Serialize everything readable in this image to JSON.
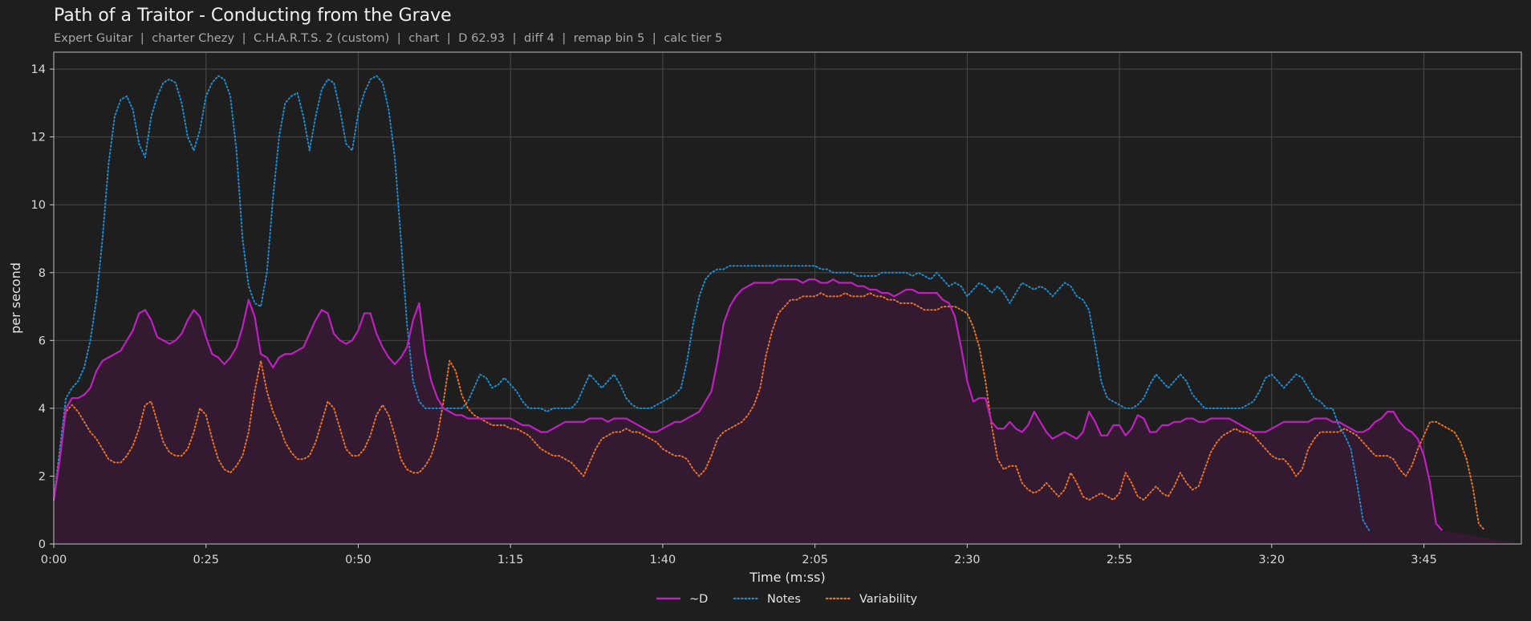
{
  "page": {
    "title": "Path of a Traitor - Conducting from the Grave",
    "subtitle": "Expert Guitar  |  charter Chezy  |  C.H.A.R.T.S. 2 (custom)  |  chart  |  D 62.93  |  diff 4  |  remap bin 5  |  calc tier 5"
  },
  "chart_data": {
    "type": "line",
    "title": "Path of a Traitor - Conducting from the Grave",
    "xlabel": "Time (m:ss)",
    "ylabel": "per second",
    "xlim": [
      0,
      241
    ],
    "ylim": [
      0,
      14.5
    ],
    "grid": true,
    "legend_position": "bottom-center",
    "x_ticks": [
      {
        "value": 0,
        "label": "0:00"
      },
      {
        "value": 25,
        "label": "0:25"
      },
      {
        "value": 50,
        "label": "0:50"
      },
      {
        "value": 75,
        "label": "1:15"
      },
      {
        "value": 100,
        "label": "1:40"
      },
      {
        "value": 125,
        "label": "2:05"
      },
      {
        "value": 150,
        "label": "2:30"
      },
      {
        "value": 175,
        "label": "2:55"
      },
      {
        "value": 200,
        "label": "3:20"
      },
      {
        "value": 225,
        "label": "3:45"
      }
    ],
    "y_ticks": [
      {
        "value": 0,
        "label": "0"
      },
      {
        "value": 2,
        "label": "2"
      },
      {
        "value": 4,
        "label": "4"
      },
      {
        "value": 6,
        "label": "6"
      },
      {
        "value": 8,
        "label": "8"
      },
      {
        "value": 10,
        "label": "10"
      },
      {
        "value": 12,
        "label": "12"
      },
      {
        "value": 14,
        "label": "14"
      }
    ],
    "x": [
      0,
      1,
      2,
      3,
      4,
      5,
      6,
      7,
      8,
      9,
      10,
      11,
      12,
      13,
      14,
      15,
      16,
      17,
      18,
      19,
      20,
      21,
      22,
      23,
      24,
      25,
      26,
      27,
      28,
      29,
      30,
      31,
      32,
      33,
      34,
      35,
      36,
      37,
      38,
      39,
      40,
      41,
      42,
      43,
      44,
      45,
      46,
      47,
      48,
      49,
      50,
      51,
      52,
      53,
      54,
      55,
      56,
      57,
      58,
      59,
      60,
      61,
      62,
      63,
      64,
      65,
      66,
      67,
      68,
      69,
      70,
      71,
      72,
      73,
      74,
      75,
      76,
      77,
      78,
      79,
      80,
      81,
      82,
      83,
      84,
      85,
      86,
      87,
      88,
      89,
      90,
      91,
      92,
      93,
      94,
      95,
      96,
      97,
      98,
      99,
      100,
      101,
      102,
      103,
      104,
      105,
      106,
      107,
      108,
      109,
      110,
      111,
      112,
      113,
      114,
      115,
      116,
      117,
      118,
      119,
      120,
      121,
      122,
      123,
      124,
      125,
      126,
      127,
      128,
      129,
      130,
      131,
      132,
      133,
      134,
      135,
      136,
      137,
      138,
      139,
      140,
      141,
      142,
      143,
      144,
      145,
      146,
      147,
      148,
      149,
      150,
      151,
      152,
      153,
      154,
      155,
      156,
      157,
      158,
      159,
      160,
      161,
      162,
      163,
      164,
      165,
      166,
      167,
      168,
      169,
      170,
      171,
      172,
      173,
      174,
      175,
      176,
      177,
      178,
      179,
      180,
      181,
      182,
      183,
      184,
      185,
      186,
      187,
      188,
      189,
      190,
      191,
      192,
      193,
      194,
      195,
      196,
      197,
      198,
      199,
      200,
      201,
      202,
      203,
      204,
      205,
      206,
      207,
      208,
      209,
      210,
      211,
      212,
      213,
      214,
      215,
      216,
      217,
      218,
      219,
      220,
      221,
      222,
      223,
      224,
      225,
      226,
      227,
      228,
      229,
      230,
      231,
      232,
      233,
      234,
      235,
      236,
      237,
      238,
      239,
      240,
      241
    ],
    "series": [
      {
        "name": "~D",
        "color": "#c020c0",
        "style": "solid",
        "fill": "#331a31",
        "values": [
          1.3,
          2.5,
          4.0,
          4.3,
          4.3,
          4.4,
          4.6,
          5.1,
          5.4,
          5.5,
          5.6,
          5.7,
          6.0,
          6.3,
          6.8,
          6.9,
          6.6,
          6.1,
          6.0,
          5.9,
          6.0,
          6.2,
          6.6,
          6.9,
          6.7,
          6.1,
          5.6,
          5.5,
          5.3,
          5.5,
          5.8,
          6.4,
          7.2,
          6.7,
          5.6,
          5.5,
          5.2,
          5.5,
          5.6,
          5.6,
          5.7,
          5.8,
          6.2,
          6.6,
          6.9,
          6.8,
          6.2,
          6.0,
          5.9,
          6.0,
          6.3,
          6.8,
          6.8,
          6.2,
          5.8,
          5.5,
          5.3,
          5.5,
          5.8,
          6.6,
          7.1,
          5.6,
          4.8,
          4.3,
          4.0,
          3.9,
          3.8,
          3.8,
          3.7,
          3.7,
          3.7,
          3.7,
          3.7,
          3.7,
          3.7,
          3.7,
          3.6,
          3.5,
          3.5,
          3.4,
          3.3,
          3.3,
          3.4,
          3.5,
          3.6,
          3.6,
          3.6,
          3.6,
          3.7,
          3.7,
          3.7,
          3.6,
          3.7,
          3.7,
          3.7,
          3.6,
          3.5,
          3.4,
          3.3,
          3.3,
          3.4,
          3.5,
          3.6,
          3.6,
          3.7,
          3.8,
          3.9,
          4.2,
          4.5,
          5.4,
          6.5,
          7.0,
          7.3,
          7.5,
          7.6,
          7.7,
          7.7,
          7.7,
          7.7,
          7.8,
          7.8,
          7.8,
          7.8,
          7.7,
          7.8,
          7.8,
          7.7,
          7.7,
          7.8,
          7.7,
          7.7,
          7.7,
          7.6,
          7.6,
          7.5,
          7.5,
          7.4,
          7.4,
          7.3,
          7.4,
          7.5,
          7.5,
          7.4,
          7.4,
          7.4,
          7.4,
          7.2,
          7.1,
          6.7,
          5.8,
          4.8,
          4.2,
          4.3,
          4.3,
          3.6,
          3.4,
          3.4,
          3.6,
          3.4,
          3.3,
          3.5,
          3.9,
          3.6,
          3.3,
          3.1,
          3.2,
          3.3,
          3.2,
          3.1,
          3.3,
          3.9,
          3.6,
          3.2,
          3.2,
          3.5,
          3.5,
          3.2,
          3.4,
          3.8,
          3.7,
          3.3,
          3.3,
          3.5,
          3.5,
          3.6,
          3.6,
          3.7,
          3.7,
          3.6,
          3.6,
          3.7,
          3.7,
          3.7,
          3.7,
          3.6,
          3.5,
          3.4,
          3.3,
          3.3,
          3.3,
          3.4,
          3.5,
          3.6,
          3.6,
          3.6,
          3.6,
          3.6,
          3.7,
          3.7,
          3.7,
          3.6,
          3.6,
          3.5,
          3.4,
          3.3,
          3.3,
          3.4,
          3.6,
          3.7,
          3.9,
          3.9,
          3.6,
          3.4,
          3.3,
          3.1,
          2.6,
          1.8,
          0.6,
          0.4
        ]
      },
      {
        "name": "Notes",
        "color": "#1f8ccc",
        "style": "dotted",
        "values": [
          1.3,
          2.8,
          4.3,
          4.6,
          4.8,
          5.2,
          6.0,
          7.2,
          9.0,
          11.2,
          12.6,
          13.1,
          13.2,
          12.8,
          11.8,
          11.4,
          12.6,
          13.2,
          13.6,
          13.7,
          13.6,
          13.0,
          12.0,
          11.6,
          12.2,
          13.2,
          13.6,
          13.8,
          13.7,
          13.2,
          11.6,
          9.0,
          7.6,
          7.1,
          7.0,
          8.0,
          10.2,
          12.0,
          13.0,
          13.2,
          13.3,
          12.6,
          11.6,
          12.6,
          13.4,
          13.7,
          13.6,
          12.8,
          11.8,
          11.6,
          12.7,
          13.3,
          13.7,
          13.8,
          13.6,
          12.8,
          11.4,
          9.0,
          6.5,
          4.8,
          4.2,
          4.0,
          4.0,
          4.0,
          4.0,
          4.0,
          4.0,
          4.0,
          4.2,
          4.6,
          5.0,
          4.9,
          4.6,
          4.7,
          4.9,
          4.7,
          4.5,
          4.2,
          4.0,
          4.0,
          4.0,
          3.9,
          4.0,
          4.0,
          4.0,
          4.0,
          4.2,
          4.6,
          5.0,
          4.8,
          4.6,
          4.8,
          5.0,
          4.7,
          4.3,
          4.1,
          4.0,
          4.0,
          4.0,
          4.1,
          4.2,
          4.3,
          4.4,
          4.6,
          5.4,
          6.5,
          7.3,
          7.8,
          8.0,
          8.1,
          8.1,
          8.2,
          8.2,
          8.2,
          8.2,
          8.2,
          8.2,
          8.2,
          8.2,
          8.2,
          8.2,
          8.2,
          8.2,
          8.2,
          8.2,
          8.2,
          8.1,
          8.1,
          8.0,
          8.0,
          8.0,
          8.0,
          7.9,
          7.9,
          7.9,
          7.9,
          8.0,
          8.0,
          8.0,
          8.0,
          8.0,
          7.9,
          8.0,
          7.9,
          7.8,
          8.0,
          7.8,
          7.6,
          7.7,
          7.6,
          7.3,
          7.5,
          7.7,
          7.6,
          7.4,
          7.6,
          7.4,
          7.1,
          7.4,
          7.7,
          7.6,
          7.5,
          7.6,
          7.5,
          7.3,
          7.5,
          7.7,
          7.6,
          7.3,
          7.2,
          6.9,
          5.9,
          4.8,
          4.3,
          4.2,
          4.1,
          4.0,
          4.0,
          4.1,
          4.3,
          4.7,
          5.0,
          4.8,
          4.6,
          4.8,
          5.0,
          4.8,
          4.4,
          4.2,
          4.0,
          4.0,
          4.0,
          4.0,
          4.0,
          4.0,
          4.0,
          4.1,
          4.2,
          4.5,
          4.9,
          5.0,
          4.8,
          4.6,
          4.8,
          5.0,
          4.9,
          4.6,
          4.3,
          4.2,
          4.0,
          4.0,
          3.5,
          3.2,
          2.8,
          1.8,
          0.7,
          0.4
        ]
      },
      {
        "name": "Variability",
        "color": "#e8732a",
        "style": "dotted",
        "values": [
          1.3,
          2.6,
          3.9,
          4.1,
          3.9,
          3.6,
          3.3,
          3.1,
          2.8,
          2.5,
          2.4,
          2.4,
          2.6,
          2.9,
          3.4,
          4.1,
          4.2,
          3.6,
          3.0,
          2.7,
          2.6,
          2.6,
          2.8,
          3.3,
          4.0,
          3.8,
          3.1,
          2.5,
          2.2,
          2.1,
          2.3,
          2.6,
          3.3,
          4.5,
          5.4,
          4.5,
          3.9,
          3.5,
          3.0,
          2.7,
          2.5,
          2.5,
          2.6,
          3.0,
          3.6,
          4.2,
          4.0,
          3.4,
          2.8,
          2.6,
          2.6,
          2.8,
          3.2,
          3.8,
          4.1,
          3.8,
          3.2,
          2.5,
          2.2,
          2.1,
          2.1,
          2.3,
          2.6,
          3.2,
          4.2,
          5.4,
          5.1,
          4.4,
          4.0,
          3.8,
          3.7,
          3.6,
          3.5,
          3.5,
          3.5,
          3.4,
          3.4,
          3.3,
          3.2,
          3.0,
          2.8,
          2.7,
          2.6,
          2.6,
          2.5,
          2.4,
          2.2,
          2.0,
          2.4,
          2.8,
          3.1,
          3.2,
          3.3,
          3.3,
          3.4,
          3.3,
          3.3,
          3.2,
          3.1,
          3.0,
          2.8,
          2.7,
          2.6,
          2.6,
          2.5,
          2.2,
          2.0,
          2.2,
          2.6,
          3.1,
          3.3,
          3.4,
          3.5,
          3.6,
          3.8,
          4.1,
          4.6,
          5.6,
          6.3,
          6.8,
          7.0,
          7.2,
          7.2,
          7.3,
          7.3,
          7.3,
          7.4,
          7.3,
          7.3,
          7.3,
          7.4,
          7.3,
          7.3,
          7.3,
          7.4,
          7.3,
          7.3,
          7.2,
          7.2,
          7.1,
          7.1,
          7.1,
          7.0,
          6.9,
          6.9,
          6.9,
          7.0,
          7.0,
          7.0,
          6.9,
          6.8,
          6.4,
          5.8,
          4.8,
          3.5,
          2.5,
          2.2,
          2.3,
          2.3,
          1.8,
          1.6,
          1.5,
          1.6,
          1.8,
          1.6,
          1.4,
          1.6,
          2.1,
          1.8,
          1.4,
          1.3,
          1.4,
          1.5,
          1.4,
          1.3,
          1.5,
          2.1,
          1.8,
          1.4,
          1.3,
          1.5,
          1.7,
          1.5,
          1.4,
          1.7,
          2.1,
          1.8,
          1.6,
          1.7,
          2.2,
          2.7,
          3.0,
          3.2,
          3.3,
          3.4,
          3.3,
          3.3,
          3.2,
          3.0,
          2.8,
          2.6,
          2.5,
          2.5,
          2.3,
          2.0,
          2.2,
          2.8,
          3.1,
          3.3,
          3.3,
          3.3,
          3.3,
          3.4,
          3.3,
          3.2,
          3.0,
          2.8,
          2.6,
          2.6,
          2.6,
          2.5,
          2.2,
          2.0,
          2.3,
          2.8,
          3.2,
          3.6,
          3.6,
          3.5,
          3.4,
          3.3,
          3.0,
          2.5,
          1.7,
          0.6,
          0.4
        ]
      }
    ]
  }
}
